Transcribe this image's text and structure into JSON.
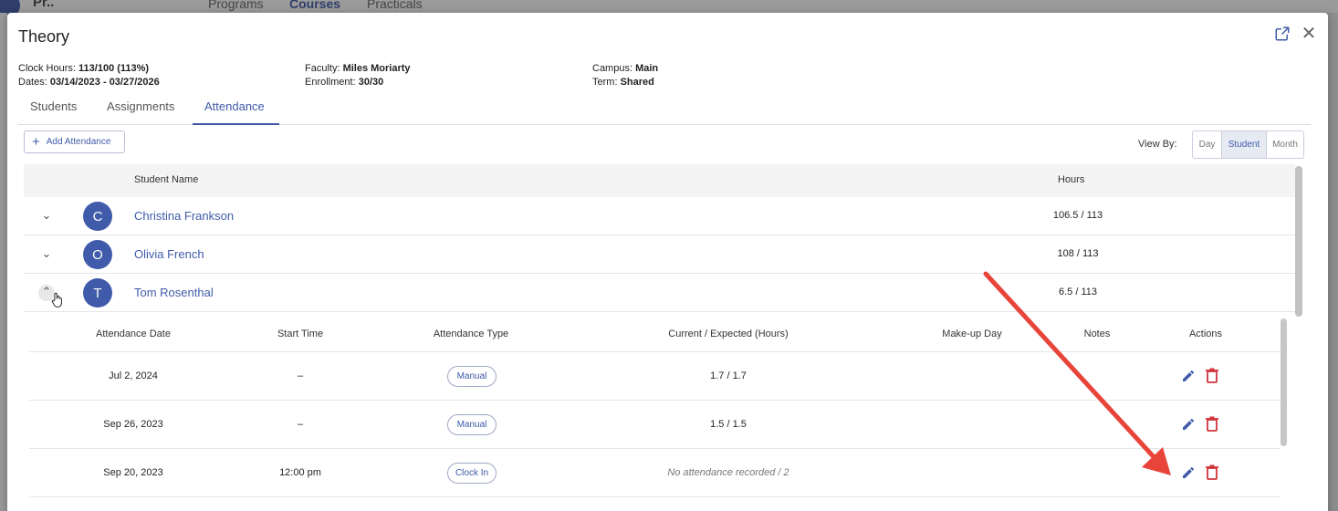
{
  "background": {
    "brand": "Pr..",
    "nav": [
      "Programs",
      "Courses",
      "Practicals"
    ]
  },
  "modal": {
    "title": "Theory",
    "info": {
      "clock_hours_label": "Clock Hours:",
      "clock_hours_value": "113/100 (113%)",
      "dates_label": "Dates:",
      "dates_value": "03/14/2023 - 03/27/2026",
      "faculty_label": "Faculty:",
      "faculty_value": "Miles Moriarty",
      "enrollment_label": "Enrollment:",
      "enrollment_value": "30/30",
      "campus_label": "Campus:",
      "campus_value": "Main",
      "term_label": "Term:",
      "term_value": "Shared"
    },
    "tabs": [
      "Students",
      "Assignments",
      "Attendance"
    ],
    "active_tab": "Attendance",
    "add_attendance_label": "Add Attendance",
    "view_by": {
      "label": "View By:",
      "options": [
        "Day",
        "Student",
        "Month"
      ],
      "selected": "Student"
    },
    "table": {
      "headers": {
        "student_name": "Student Name",
        "hours": "Hours"
      },
      "rows": [
        {
          "initial": "C",
          "name": "Christina Frankson",
          "hours": "106.5 / 113"
        },
        {
          "initial": "O",
          "name": "Olivia French",
          "hours": "108 / 113"
        },
        {
          "initial": "T",
          "name": "Tom Rosenthal",
          "hours": "6.5 / 113"
        }
      ]
    },
    "detail": {
      "headers": {
        "date": "Attendance Date",
        "start": "Start Time",
        "type": "Attendance Type",
        "current": "Current / Expected (Hours)",
        "makeup": "Make-up Day",
        "notes": "Notes",
        "actions": "Actions"
      },
      "rows": [
        {
          "date": "Jul 2, 2024",
          "start": "–",
          "type": "Manual",
          "current": "1.7 / 1.7"
        },
        {
          "date": "Sep 26, 2023",
          "start": "–",
          "type": "Manual",
          "current": "1.5 / 1.5"
        },
        {
          "date": "Sep 20, 2023",
          "start": "12:00 pm",
          "type": "Clock In",
          "current": "No attendance recorded / 2"
        }
      ]
    }
  },
  "colors": {
    "accent": "#3f5ba9",
    "delete": "#d0343b",
    "annotation_arrow": "#e8443a"
  }
}
